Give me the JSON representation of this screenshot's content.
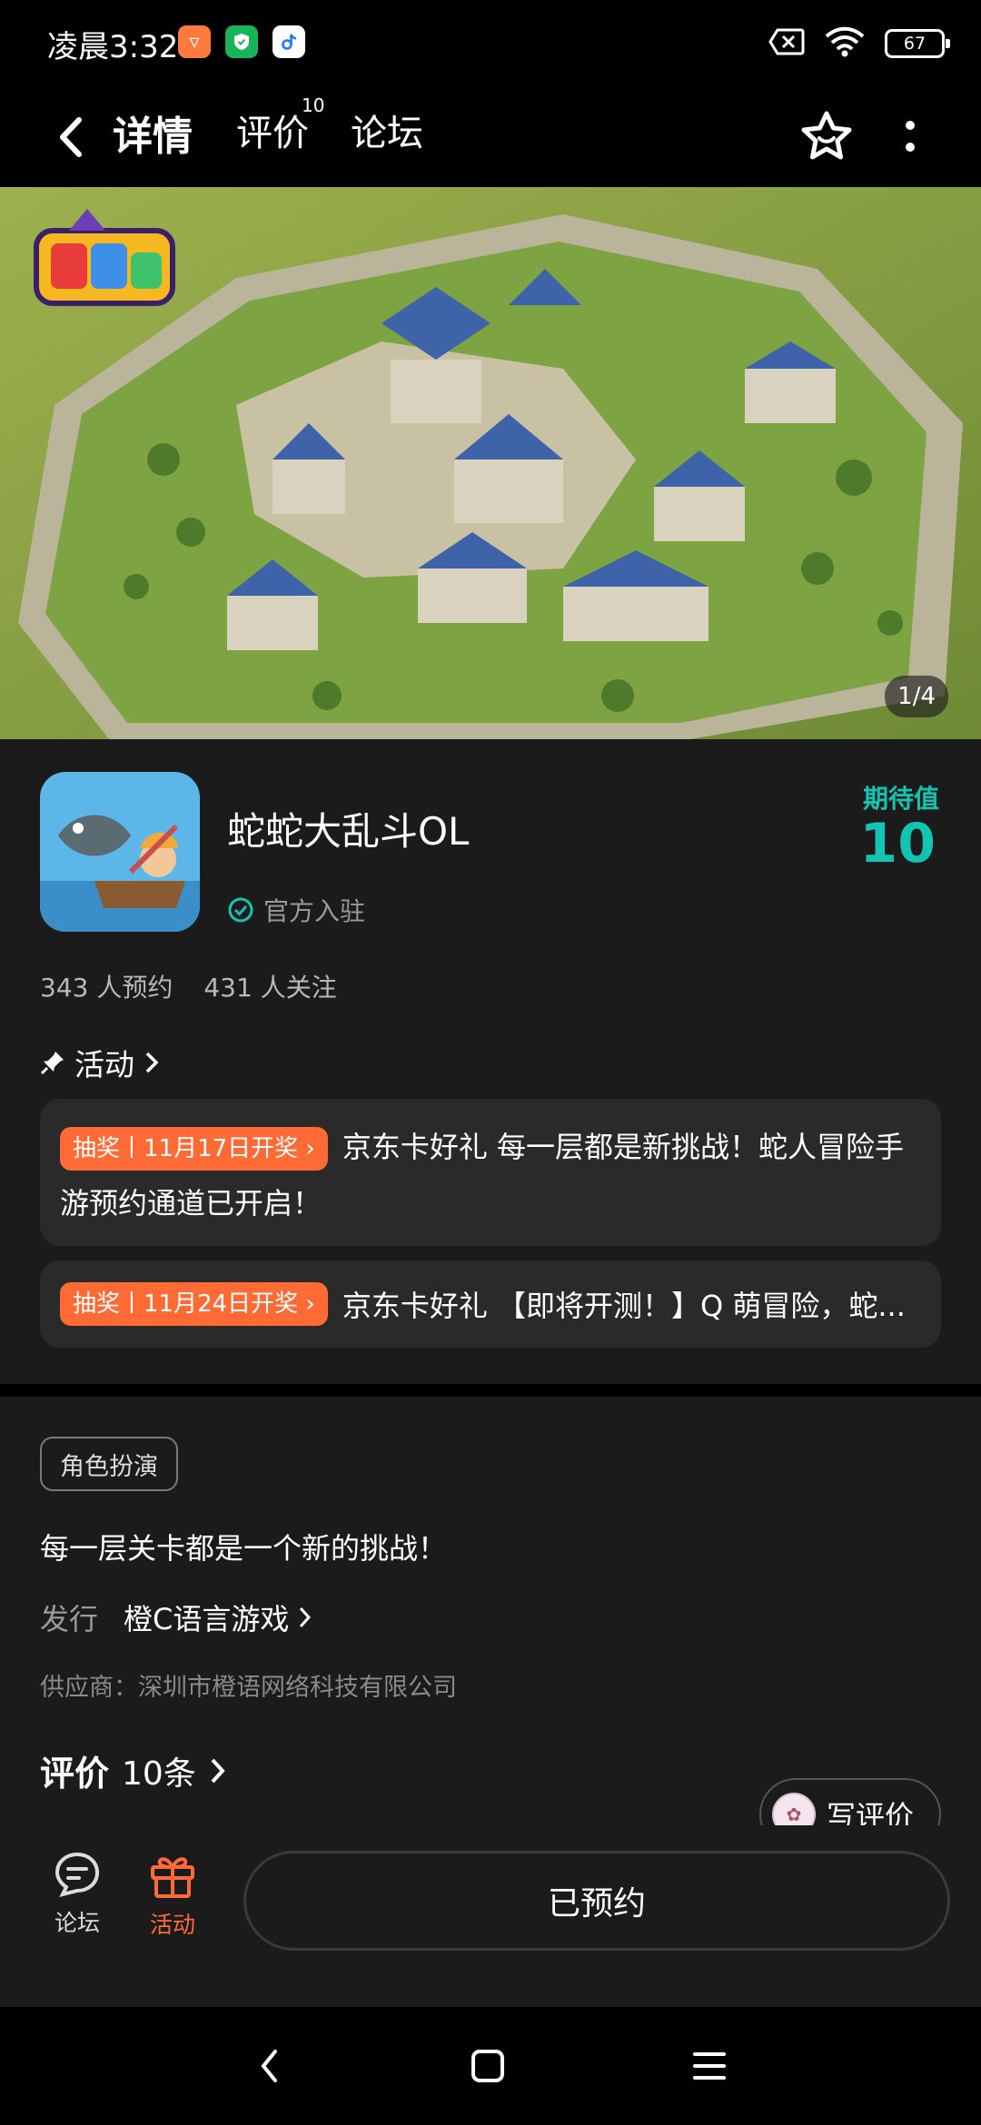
{
  "status_bar": {
    "time": "凌晨3:32",
    "battery": "67",
    "app_icons": [
      "taobao-icon",
      "shield-app-icon",
      "douyin-icon"
    ],
    "status_icons": [
      "sim-x-icon",
      "wifi-icon",
      "battery-icon"
    ]
  },
  "nav": {
    "tabs": [
      {
        "label": "详情",
        "active": true
      },
      {
        "label": "评价",
        "badge": "10"
      },
      {
        "label": "论坛"
      }
    ],
    "icons": [
      "back-icon",
      "star-icon",
      "more-icon"
    ]
  },
  "banner": {
    "page_indicator": "1/4"
  },
  "game": {
    "title": "蛇蛇大乱斗OL",
    "official": "官方入驻",
    "expect_label": "期待值",
    "expect_value": "10",
    "reservations": "343 人预约",
    "followers": "431 人关注"
  },
  "activity": {
    "heading": "活动",
    "items": [
      {
        "tag": "抽奖丨11月17日开奖",
        "text": "京东卡好礼 每一层都是新挑战！蛇人冒险手游预约通道已开启！"
      },
      {
        "tag": "抽奖丨11月24日开奖",
        "text": "京东卡好礼 【即将开测！】Q 萌冒险，蛇..."
      }
    ]
  },
  "detail": {
    "genre": "角色扮演",
    "description": "每一层关卡都是一个新的挑战！",
    "publisher_label": "发行",
    "publisher_name": "橙C语言游戏",
    "supplier": "供应商：深圳市橙语网络科技有限公司"
  },
  "reviews": {
    "title": "评价",
    "count": "10条",
    "write_label": "写评价"
  },
  "bottom_bar": {
    "forum_label": "论坛",
    "activity_label": "活动",
    "reserved_label": "已预约"
  },
  "colors": {
    "accent": "#14c4b2",
    "lottery_tag": "#ff6a35",
    "card_bg": "#1b1b1b"
  }
}
